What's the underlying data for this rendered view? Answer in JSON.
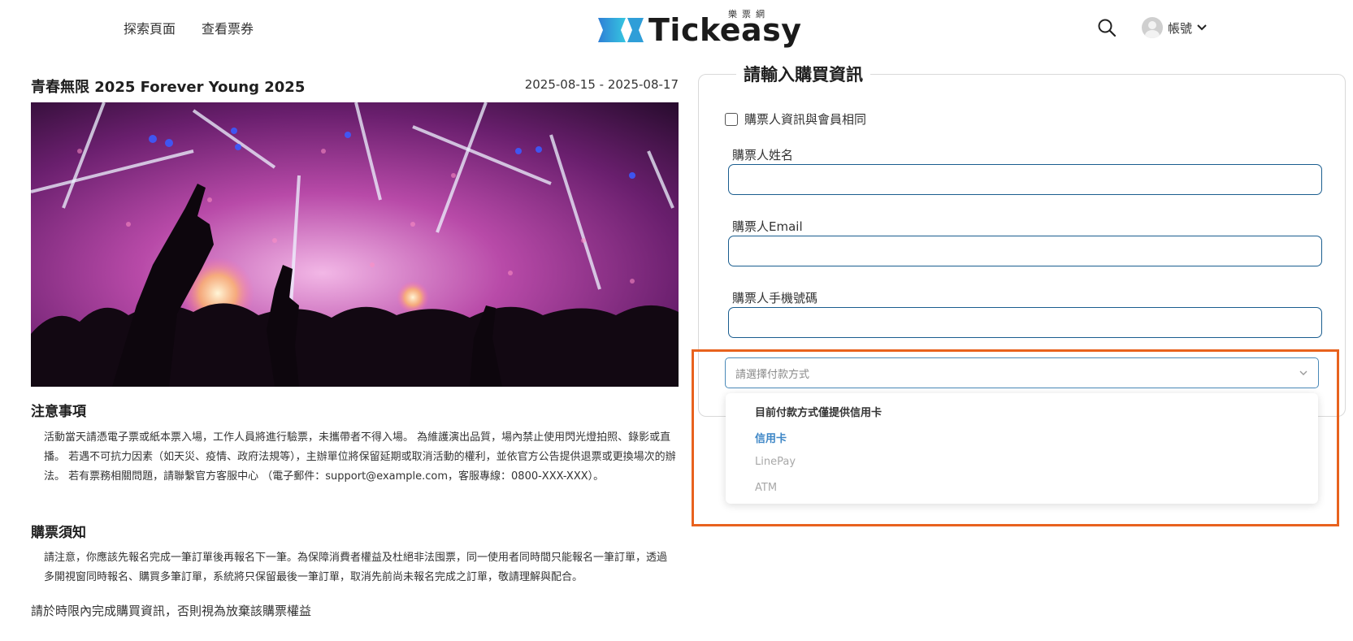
{
  "header": {
    "nav": [
      {
        "label": "探索頁面"
      },
      {
        "label": "查看票券"
      }
    ],
    "logo": {
      "text": "Tickeasy",
      "subtext": "樂票網"
    },
    "account_label": "帳號"
  },
  "event": {
    "title": "青春無限 2025 Forever Young 2025",
    "date_range": "2025-08-15 - 2025-08-17"
  },
  "notes": {
    "title": "注意事項",
    "body": "活動當天請憑電子票或紙本票入場，工作人員將進行驗票，未攜帶者不得入場。 為維護演出品質，場內禁止使用閃光燈拍照、錄影或直播。 若遇不可抗力因素（如天災、疫情、政府法規等），主辦單位將保留延期或取消活動的權利，並依官方公告提供退票或更換場次的辦法。 若有票務相關問題，請聯繫官方客服中心 （電子郵件：support@example.com，客服專線：0800-XXX-XXX）。"
  },
  "purchase_notes": {
    "title": "購票須知",
    "body": "請注意，你應該先報名完成一筆訂單後再報名下一筆。為保障消費者權益及杜絕非法囤票，同一使用者同時間只能報名一筆訂單，透過多開視窗同時報名、購買多筆訂單，系統將只保留最後一筆訂單，取消先前尚未報名完成之訂單，敬請理解與配合。"
  },
  "deadline_text": "請於時限內完成購買資訊，否則視為放棄該購票權益",
  "form": {
    "legend": "請輸入購買資訊",
    "same_as_member_label": "購票人資訊與會員相同",
    "same_as_member_checked": false,
    "name_label": "購票人姓名",
    "name_value": "",
    "email_label": "購票人Email",
    "email_value": "",
    "phone_label": "購票人手機號碼",
    "phone_value": "",
    "payment": {
      "placeholder": "請選擇付款方式",
      "options_header": "目前付款方式僅提供信用卡",
      "options": [
        {
          "label": "信用卡",
          "state": "enabled"
        },
        {
          "label": "LinePay",
          "state": "disabled"
        },
        {
          "label": "ATM",
          "state": "disabled"
        }
      ]
    }
  },
  "colors": {
    "field_border": "#1a5d8f",
    "select_border": "#4a89b8",
    "option_selected": "#3d86c6",
    "highlight": "#e8621e",
    "logo_mark": "#2f7fd6"
  },
  "icons": {
    "search": "search-icon",
    "avatar": "user-avatar-icon",
    "account_chevron": "chevron-down-icon",
    "select_chevron": "chevron-down-icon"
  }
}
